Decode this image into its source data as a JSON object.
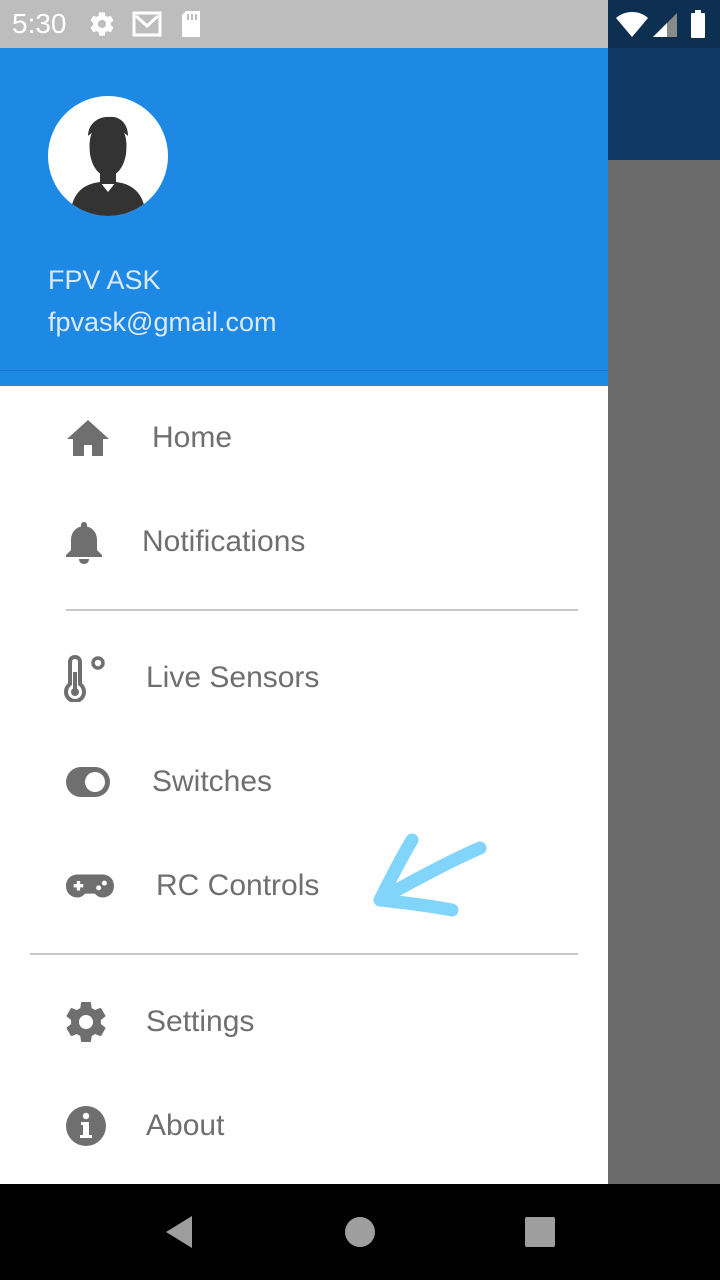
{
  "status_bar": {
    "time": "5:30",
    "left_icons": [
      "gear-icon",
      "gmail-icon",
      "sd-card-icon"
    ],
    "right_icons": [
      "wifi-icon",
      "cell-signal-icon",
      "battery-icon"
    ]
  },
  "drawer": {
    "header": {
      "name": "FPV ASK",
      "email": "fpvask@gmail.com",
      "avatar_icon": "person-silhouette-icon",
      "background_color": "#1e88e5"
    },
    "items": [
      {
        "label": "Home",
        "icon": "home-icon"
      },
      {
        "label": "Notifications",
        "icon": "bell-icon"
      },
      {
        "label": "Live Sensors",
        "icon": "thermometer-icon"
      },
      {
        "label": "Switches",
        "icon": "toggle-icon"
      },
      {
        "label": "RC Controls",
        "icon": "gamepad-icon"
      },
      {
        "label": "Settings",
        "icon": "gear-icon"
      },
      {
        "label": "About",
        "icon": "info-icon"
      }
    ],
    "annotation": "blue-arrow-pointing-at-rc-controls"
  },
  "nav_bar": {
    "buttons": [
      "back-icon",
      "home-circle-icon",
      "recents-square-icon"
    ]
  },
  "colors": {
    "accent": "#1e88e5",
    "icon_gray": "#6f6f6f",
    "scrim": "#6b6b6b",
    "annotation_arrow": "#81d4fa"
  }
}
